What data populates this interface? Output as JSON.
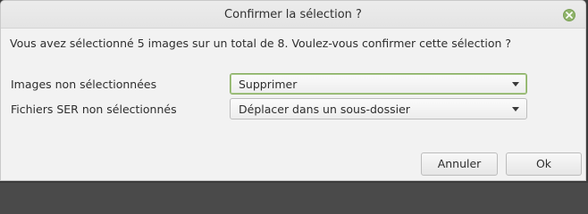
{
  "window": {
    "title": "Confirmer la sélection ?"
  },
  "message": "Vous avez sélectionné 5 images sur un total de 8. Voulez-vous confirmer cette sélection ?",
  "fields": [
    {
      "label": "Images non sélectionnées",
      "value": "Supprimer"
    },
    {
      "label": "Fichiers SER non sélectionnés",
      "value": "Déplacer dans un sous-dossier"
    }
  ],
  "buttons": {
    "cancel": "Annuler",
    "ok": "Ok"
  },
  "colors": {
    "accent": "#8fb36a",
    "dialog_bg": "#f2f2f2"
  }
}
